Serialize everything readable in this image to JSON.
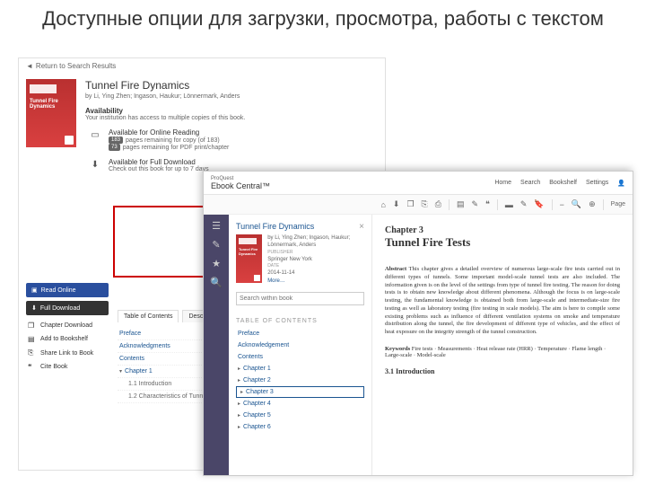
{
  "slide_title": "Доступные опции для загрузки, просмотра, работы с текстом",
  "back": {
    "return_link": "Return to Search Results",
    "book_title": "Tunnel Fire Dynamics",
    "authors": "by Li, Ying Zhen; Ingason, Haukur; Lönnermark, Anders",
    "availability_heading": "Availability",
    "availability_sub": "Your institution has access to multiple copies of this book.",
    "avail": [
      {
        "title": "Available for Online Reading",
        "badge1": "183",
        "line1": "pages remaining for copy (of 183)",
        "badge2": "73",
        "line2": "pages remaining for PDF print/chapter"
      },
      {
        "title": "Available for Full Download",
        "line": "Check out this book for up to 7 days"
      }
    ],
    "side": {
      "read": "Read Online",
      "download": "Full Download",
      "chapter": "Chapter Download",
      "bookshelf": "Add to Bookshelf",
      "share": "Share Link to Book",
      "cite": "Cite Book"
    },
    "tabs": {
      "toc": "Table of Contents",
      "desc": "Description"
    },
    "toc": {
      "preface": "Preface",
      "ack": "Acknowledgments",
      "contents": "Contents",
      "ch1": "Chapter 1",
      "s11": "1.1 Introduction",
      "s12": "1.2 Characteristics of Tunnel Fires"
    }
  },
  "front": {
    "brand_top": "ProQuest",
    "brand": "Ebook Central™",
    "nav": {
      "home": "Home",
      "search": "Search",
      "bookshelf": "Bookshelf",
      "settings": "Settings"
    },
    "toolbar_page": "Page",
    "left": {
      "title": "Tunnel Fire Dynamics",
      "by": "by Li, Ying Zhen; Ingason, Haukur; Lönnermark, Anders",
      "pub_lbl": "PUBLISHER",
      "pub": "Springer New York",
      "date_lbl": "DATE",
      "date": "2014-11-14",
      "more": "More…",
      "search_ph": "Search within book",
      "toc_h": "TABLE OF CONTENTS",
      "items": [
        "Preface",
        "Acknowledgement",
        "Contents",
        "Chapter 1",
        "Chapter 2",
        "Chapter 3",
        "Chapter 4",
        "Chapter 5",
        "Chapter 6"
      ]
    },
    "right": {
      "chnum": "Chapter 3",
      "chtitle": "Tunnel Fire Tests",
      "abs_label": "Abstract",
      "abs": "This chapter gives a detailed overview of numerous large-scale fire tests carried out in different types of tunnels. Some important model-scale tunnel tests are also included. The information given is on the level of the settings from type of tunnel fire testing. The reason for doing tests is to obtain new knowledge about different phenomena. Although the focus is on large-scale testing, the fundamental knowledge is obtained both from large-scale and intermediate-size fire testing as well as laboratory testing (fire testing in scale models). The aim is here to compile some existing problems such as influence of different ventilation systems on smoke and temperature distribution along the tunnel, the fire development of different type of vehicles, and the effect of heat exposure on the integrity strength of the tunnel construction.",
      "kw_label": "Keywords",
      "kw": "Fire tests · Measurements · Heat release rate (HRR) · Temperature · Flame length · Large-scale · Model-scale",
      "sec": "3.1  Introduction"
    }
  }
}
